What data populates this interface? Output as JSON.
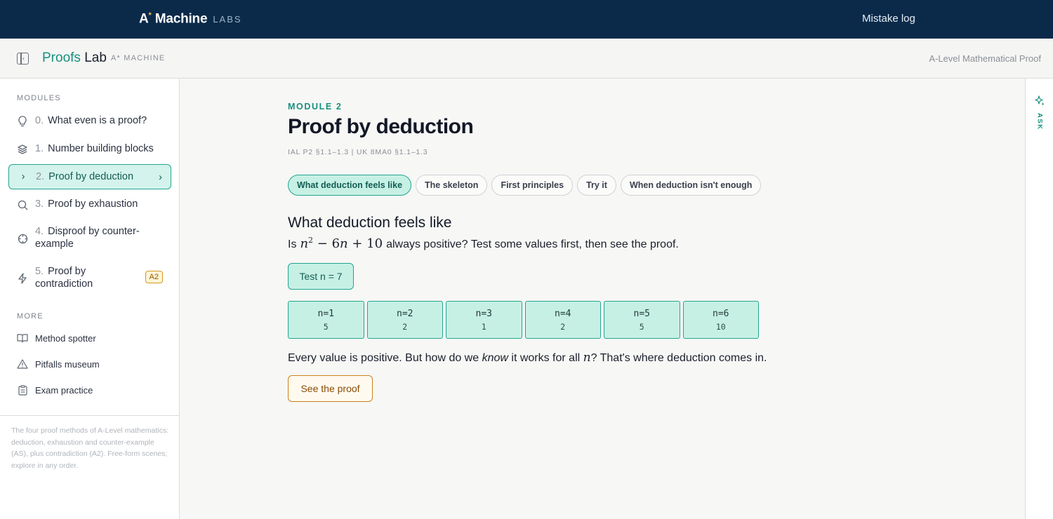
{
  "topbar": {
    "brand_main": "A",
    "brand_star": "*",
    "brand_rest": " Machine",
    "brand_labs": "LABS",
    "mistake_log": "Mistake log"
  },
  "subheader": {
    "title_a": "Proofs",
    "title_b": " Lab",
    "subtitle": "A* MACHINE",
    "course": "A-Level Mathematical Proof"
  },
  "sidebar": {
    "modules_label": "MODULES",
    "items": [
      {
        "num": "0.",
        "label": "What even is a proof?",
        "icon": "lightbulb-icon"
      },
      {
        "num": "1.",
        "label": "Number building blocks",
        "icon": "layers-icon"
      },
      {
        "num": "2.",
        "label": "Proof by deduction",
        "icon": "chevron-right-icon",
        "active": true
      },
      {
        "num": "3.",
        "label": "Proof by exhaustion",
        "icon": "search-icon"
      },
      {
        "num": "4.",
        "label": "Disproof by counter-example",
        "icon": "crosshair-icon"
      },
      {
        "num": "5.",
        "label": "Proof by contradiction",
        "icon": "lightning-icon",
        "badge": "A2"
      }
    ],
    "more_label": "MORE",
    "more_items": [
      {
        "label": "Method spotter",
        "icon": "book-icon"
      },
      {
        "label": "Pitfalls museum",
        "icon": "warning-icon"
      },
      {
        "label": "Exam practice",
        "icon": "clipboard-icon"
      }
    ],
    "note": "The four proof methods of A-Level mathematics: deduction, exhaustion and counter-example (AS), plus contradiction (A2). Free-form scenes; explore in any order."
  },
  "main": {
    "module_label": "MODULE 2",
    "title": "Proof by deduction",
    "spec": "IAL P2 §1.1–1.3 | UK 8MA0 §1.1–1.3",
    "tabs": [
      {
        "label": "What deduction feels like",
        "active": true
      },
      {
        "label": "The skeleton"
      },
      {
        "label": "First principles"
      },
      {
        "label": "Try it"
      },
      {
        "label": "When deduction isn't enough"
      }
    ],
    "section_title": "What deduction feels like",
    "question_pre": "Is",
    "question_post": "always positive? Test some values first, then see the proof.",
    "expr": {
      "var": "n",
      "exp": "2",
      "mid": " − 6",
      "var2": "n",
      "tail": " + 10"
    },
    "test_button": "Test n = 7",
    "results": [
      {
        "n": "n=1",
        "v": "5"
      },
      {
        "n": "n=2",
        "v": "2"
      },
      {
        "n": "n=3",
        "v": "1"
      },
      {
        "n": "n=4",
        "v": "2"
      },
      {
        "n": "n=5",
        "v": "5"
      },
      {
        "n": "n=6",
        "v": "10"
      }
    ],
    "conclusion_a": "Every value is positive. But how do we ",
    "conclusion_em": "know",
    "conclusion_b": " it works for all ",
    "conclusion_var": "n",
    "conclusion_c": "? That's where deduction comes in.",
    "proof_button": "See the proof"
  },
  "rail": {
    "ask_label": "ASK"
  },
  "colors": {
    "topbar": "#0b2a4a",
    "accent": "#17907f",
    "accent_light": "#c7f0e5",
    "warning": "#c9821a"
  }
}
